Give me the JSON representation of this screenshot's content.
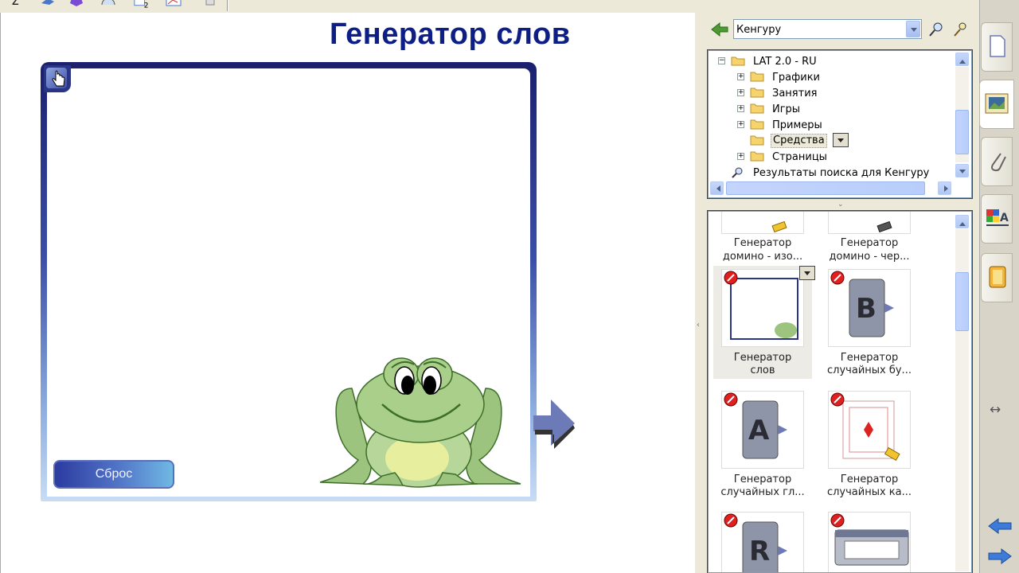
{
  "canvas": {
    "title": "Генератор слов",
    "reset_label": "Сброс"
  },
  "browser": {
    "search_value": "Кенгуру",
    "tree": {
      "root": "LAT 2.0 - RU",
      "items": [
        {
          "label": "Графики",
          "expandable": true
        },
        {
          "label": "Занятия",
          "expandable": true
        },
        {
          "label": "Игры",
          "expandable": true
        },
        {
          "label": "Примеры",
          "expandable": true
        },
        {
          "label": "Средства",
          "expandable": false,
          "selected": true
        },
        {
          "label": "Страницы",
          "expandable": true
        }
      ],
      "search_results": "Результаты поиска для Кенгуру"
    },
    "gallery": [
      {
        "caption_line1": "Генератор",
        "caption_line2": "домино - изо..."
      },
      {
        "caption_line1": "Генератор",
        "caption_line2": "домино - чер..."
      },
      {
        "caption_line1": "Генератор",
        "caption_line2": "слов"
      },
      {
        "caption_line1": "Генератор",
        "caption_line2": "случайных бу..."
      },
      {
        "caption_line1": "Генератор",
        "caption_line2": "случайных гл..."
      },
      {
        "caption_line1": "Генератор",
        "caption_line2": "случайных ка..."
      },
      {
        "caption_line1": "",
        "caption_line2": ""
      },
      {
        "caption_line1": "",
        "caption_line2": ""
      }
    ],
    "thumb_letters": {
      "b": "B",
      "a": "A",
      "r": "R"
    }
  },
  "colors": {
    "title": "#0d1f86",
    "frame_dark": "#1b1f6e",
    "accent_blue": "#3c7bd8"
  }
}
